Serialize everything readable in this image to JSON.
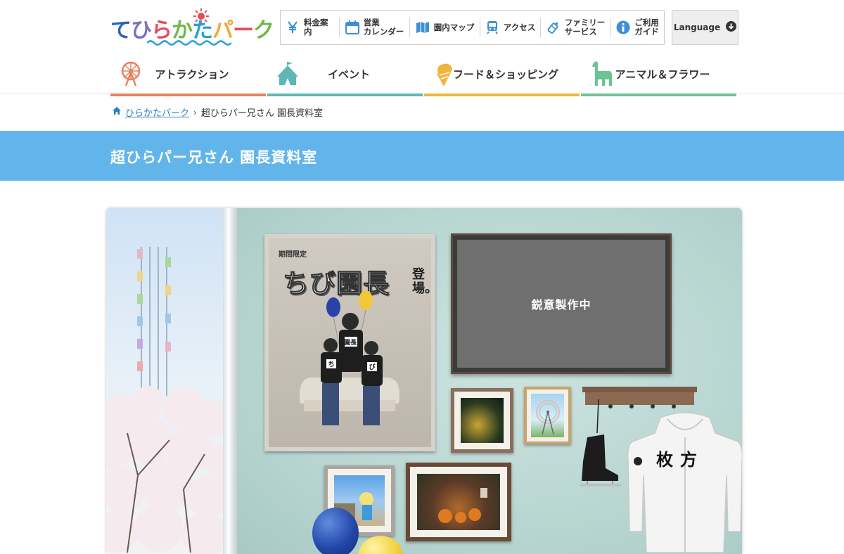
{
  "header": {
    "logo_alt": "ひらかたパーク",
    "util_nav": [
      {
        "label": "料金案内",
        "icon": "yen-icon"
      },
      {
        "label": "営業\nカレンダー",
        "icon": "calendar-icon"
      },
      {
        "label": "園内マップ",
        "icon": "map-icon"
      },
      {
        "label": "アクセス",
        "icon": "train-icon"
      },
      {
        "label": "ファミリー\nサービス",
        "icon": "baby-bottle-icon"
      },
      {
        "label": "ご利用\nガイド",
        "icon": "info-icon"
      }
    ],
    "language_label": "Language",
    "main_nav": [
      {
        "label": "アトラクション",
        "icon": "ferris-wheel-icon",
        "color": "#e8825b"
      },
      {
        "label": "イベント",
        "icon": "tent-icon",
        "color": "#5cb8b4"
      },
      {
        "label": "フード＆ショッピング",
        "icon": "ice-cream-icon",
        "color": "#f2b43c"
      },
      {
        "label": "アニマル＆フラワー",
        "icon": "alpaca-icon",
        "color": "#6cc493"
      }
    ]
  },
  "breadcrumb": {
    "home_label": "ひらかたパーク",
    "current_label": "超ひらパー兄さん 園長資料室"
  },
  "page": {
    "title": "超ひらパー兄さん 園長資料室",
    "banner_color": "#62b5ea"
  },
  "hero": {
    "poster_limited": "期間限定",
    "poster_title": "ちび園長",
    "poster_appear": "登場。",
    "tv_text": "鋭意製作中",
    "hoodie_text": "枚方",
    "chest_badges": [
      "園長",
      "ち",
      "び"
    ]
  }
}
